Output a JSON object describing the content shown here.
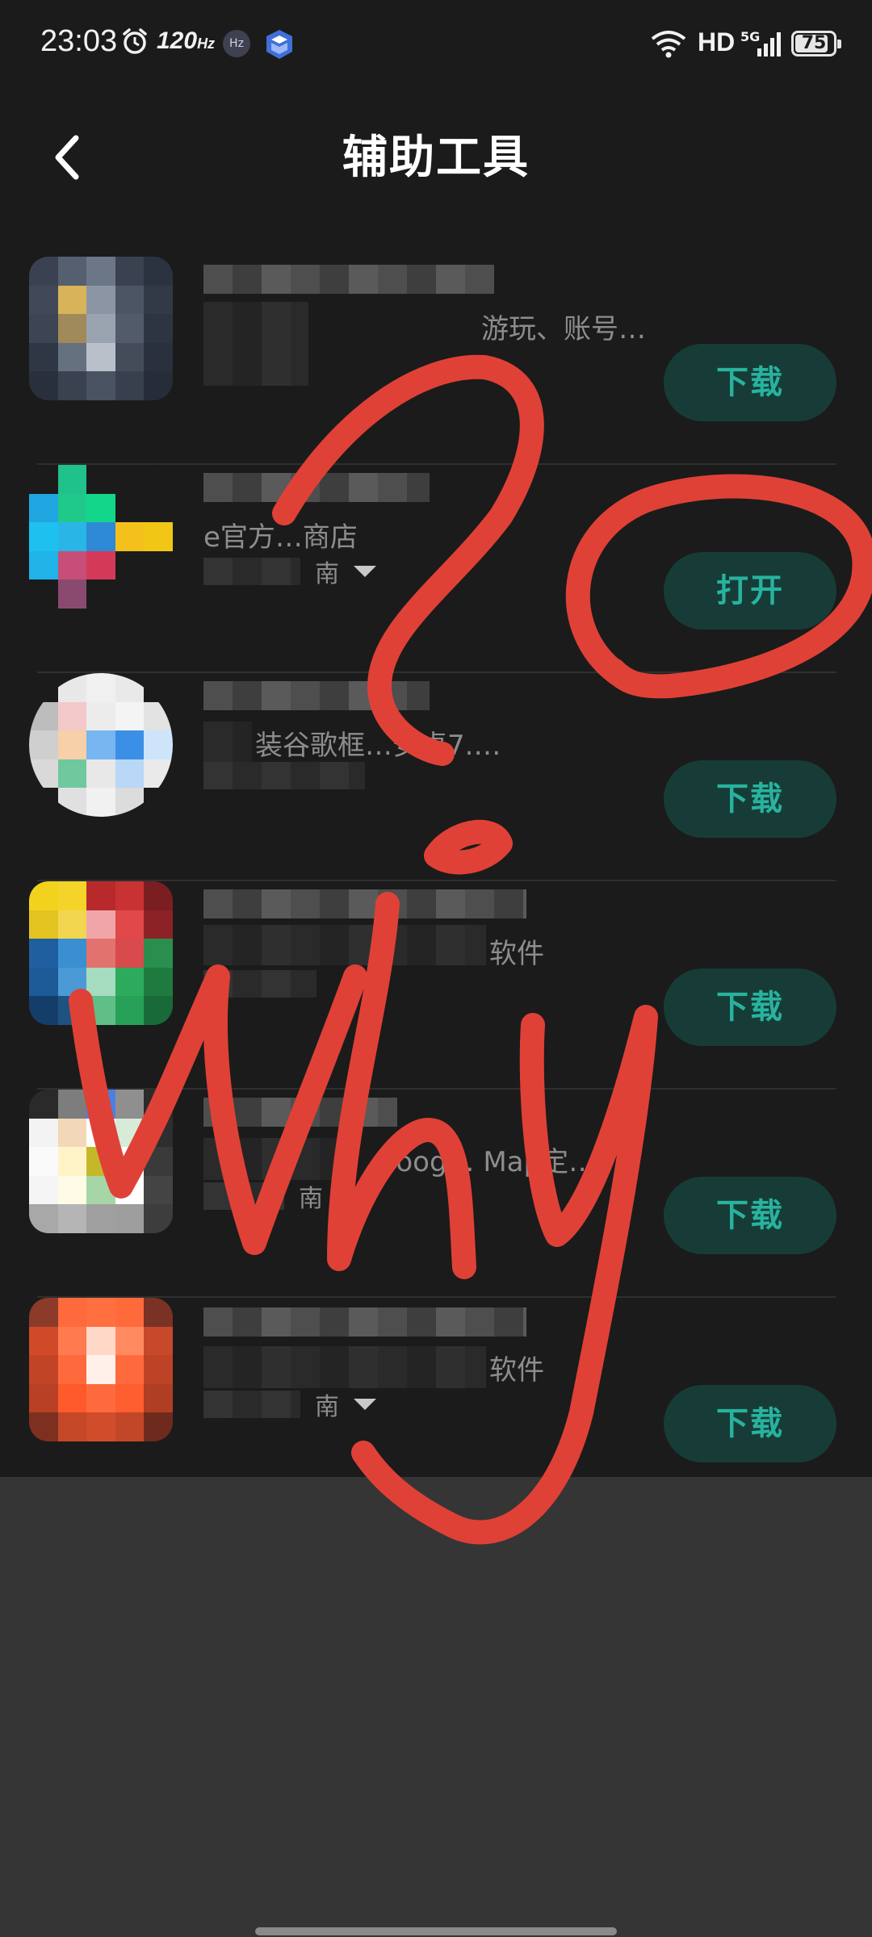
{
  "status_bar": {
    "time": "23:03",
    "refresh_rate": "120",
    "refresh_unit": "Hz",
    "hz_badge": "Hz",
    "network": "HD",
    "network_gen": "5G",
    "battery": "75"
  },
  "header": {
    "title": "辅助工具",
    "back_icon": "chevron-left-icon"
  },
  "apps": [
    {
      "desc": "游玩、账号…",
      "meta": "",
      "action": "下载",
      "meta_toggle": false
    },
    {
      "desc": "e官方…商店",
      "meta": "南",
      "action": "打开",
      "meta_toggle": true
    },
    {
      "desc": "装谷歌框…安卓7.…",
      "meta": "",
      "action": "下载",
      "meta_toggle": false
    },
    {
      "desc": "软件",
      "meta": "",
      "action": "下载",
      "meta_toggle": false
    },
    {
      "desc": "Goog… Map定…",
      "meta": "南",
      "action": "下载",
      "meta_toggle": false
    },
    {
      "desc": "软件",
      "meta": "南",
      "action": "下载",
      "meta_toggle": true
    }
  ],
  "annotation": {
    "text": "why",
    "color": "#e04136"
  },
  "colors": {
    "button_bg": "#173c37",
    "button_text": "#27b39f",
    "page_bg": "#1b1b1b"
  }
}
